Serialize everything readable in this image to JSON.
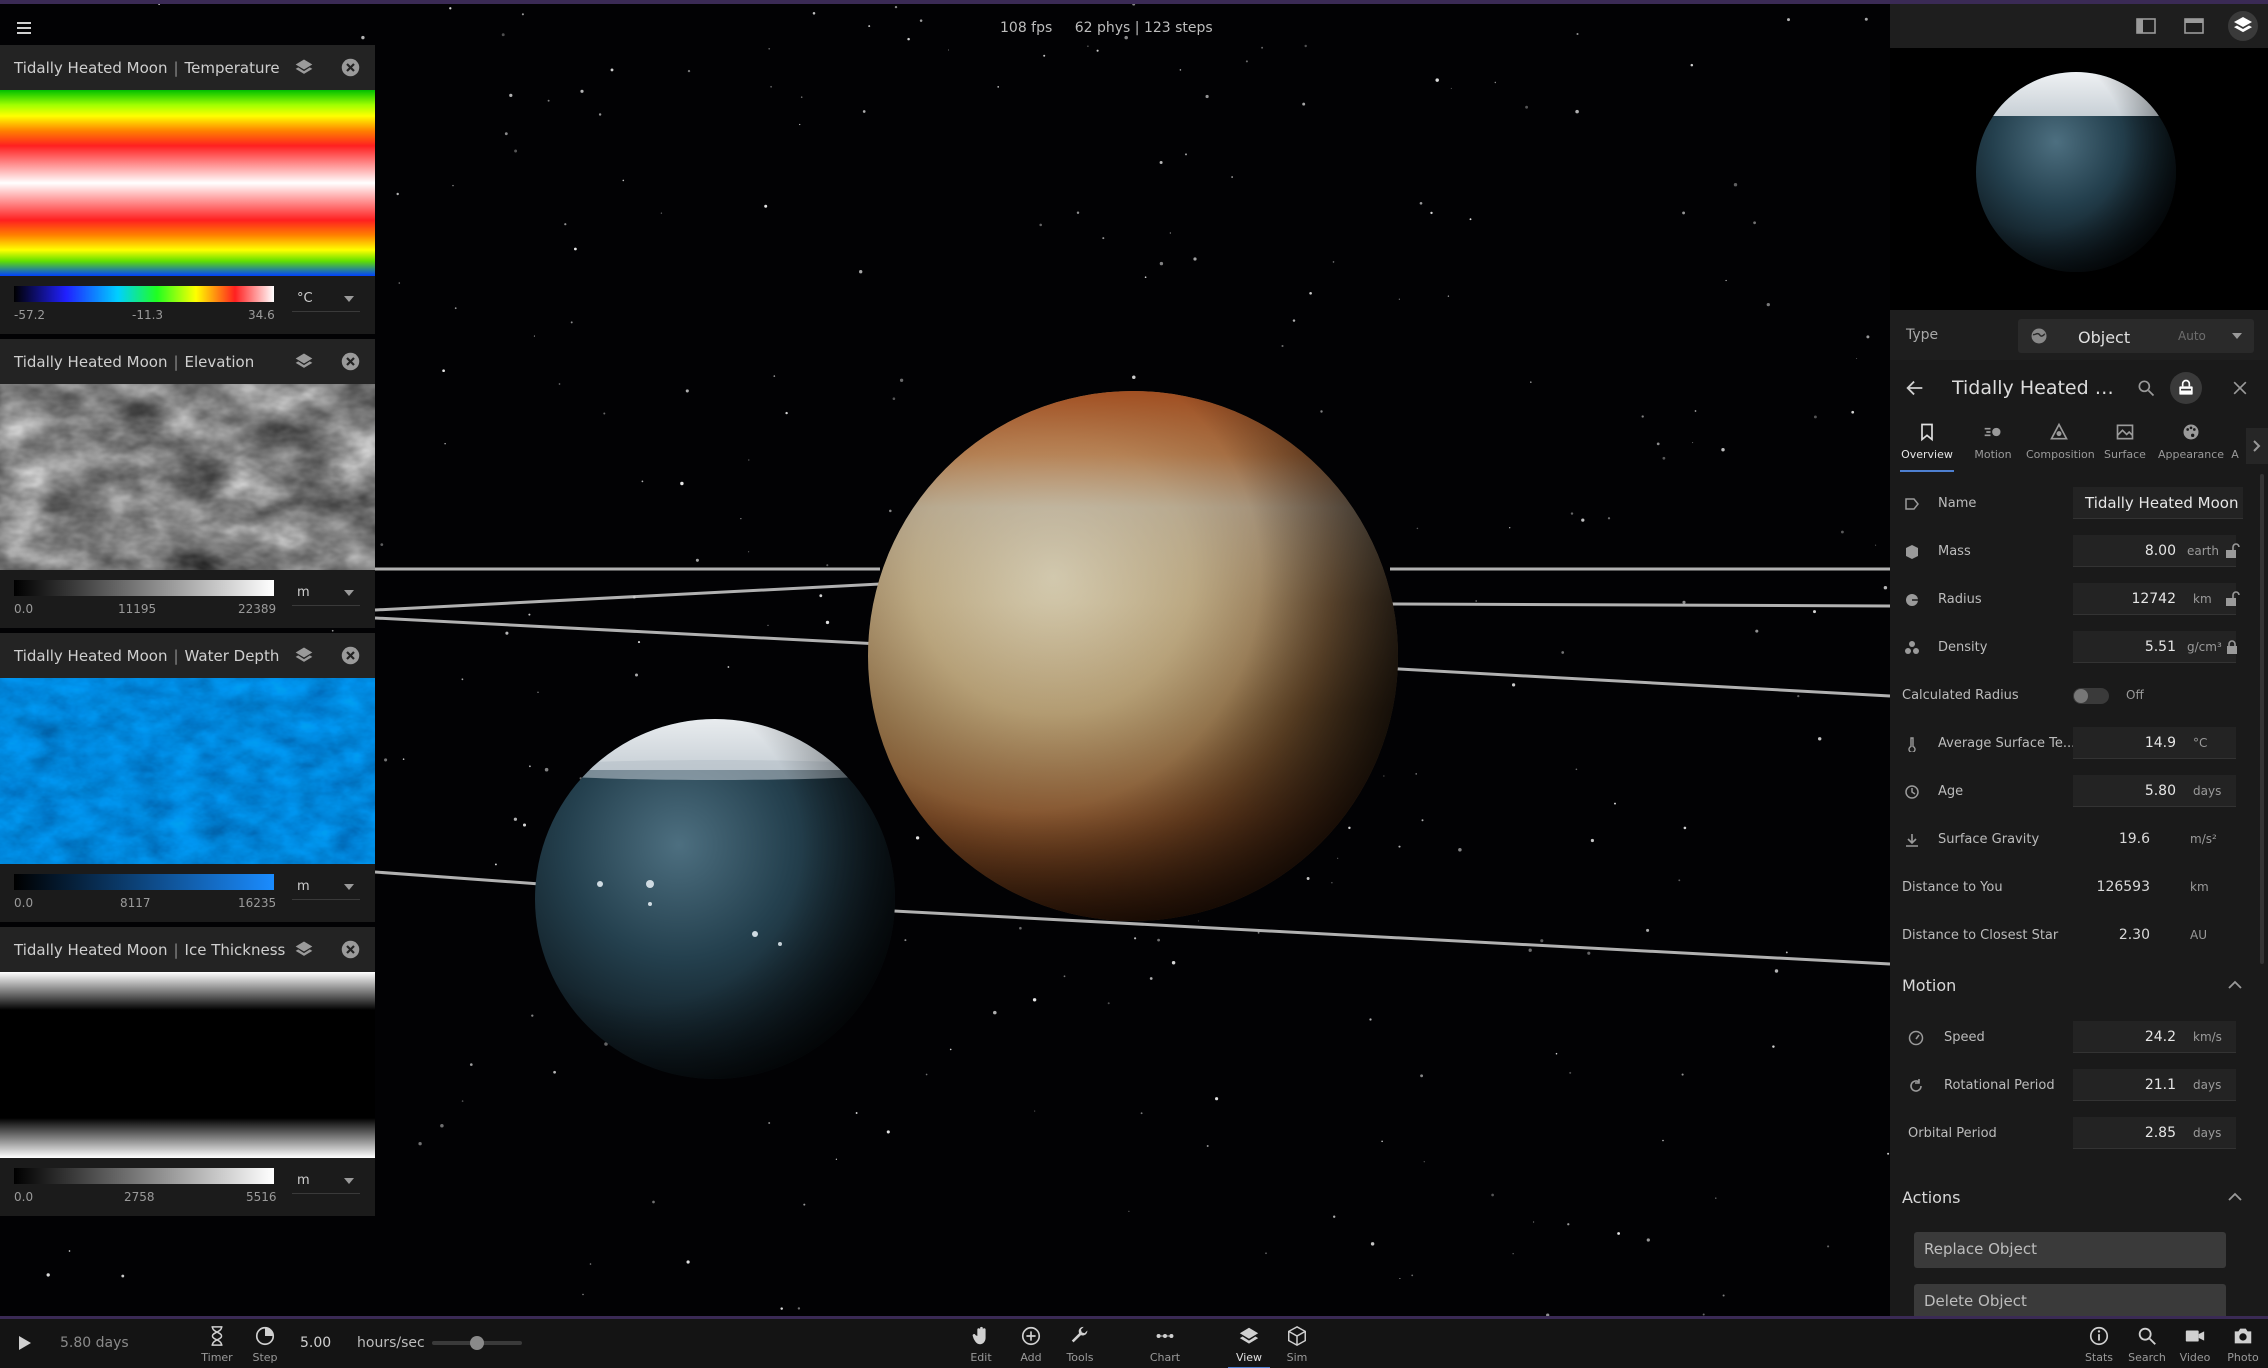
{
  "perf": {
    "fps": "108 fps",
    "phys": "62 phys | 123 steps"
  },
  "maps": [
    {
      "object": "Tidally Heated Moon",
      "sep": "|",
      "layer": "Temperature",
      "min": "-57.2",
      "mid": "-11.3",
      "max": "34.6",
      "unit": "°C"
    },
    {
      "object": "Tidally Heated Moon",
      "sep": "|",
      "layer": "Elevation",
      "min": "0.0",
      "mid": "11195",
      "max": "22389",
      "unit": "m"
    },
    {
      "object": "Tidally Heated Moon",
      "sep": "|",
      "layer": "Water Depth",
      "min": "0.0",
      "mid": "8117",
      "max": "16235",
      "unit": "m"
    },
    {
      "object": "Tidally Heated Moon",
      "sep": "|",
      "layer": "Ice Thickness",
      "min": "0.0",
      "mid": "2758",
      "max": "5516",
      "unit": "m"
    }
  ],
  "panel": {
    "type_label": "Type",
    "type_value": "Object",
    "type_auto": "Auto",
    "object_name": "Tidally Heated Mo...",
    "tabs": [
      {
        "label": "Overview",
        "icon": "bookmark-icon"
      },
      {
        "label": "Motion",
        "icon": "motion-icon"
      },
      {
        "label": "Composition",
        "icon": "composition-icon"
      },
      {
        "label": "Surface",
        "icon": "surface-icon"
      },
      {
        "label": "Appearance",
        "icon": "palette-icon"
      },
      {
        "label": "A",
        "icon": "more-icon"
      }
    ],
    "properties": {
      "name": {
        "label": "Name",
        "value": "Tidally Heated Moon"
      },
      "mass": {
        "label": "Mass",
        "value": "8.00",
        "unit": "earth"
      },
      "radius": {
        "label": "Radius",
        "value": "12742",
        "unit": "km"
      },
      "density": {
        "label": "Density",
        "value": "5.51",
        "unit": "g/cm³"
      },
      "calc_radius": {
        "label": "Calculated Radius",
        "value": "Off"
      },
      "avg_temp": {
        "label": "Average Surface Te...",
        "value": "14.9",
        "unit": "°C"
      },
      "age": {
        "label": "Age",
        "value": "5.80",
        "unit": "days"
      },
      "gravity": {
        "label": "Surface Gravity",
        "value": "19.6",
        "unit": "m/s²"
      },
      "dist_you": {
        "label": "Distance to You",
        "value": "126593",
        "unit": "km"
      },
      "dist_star": {
        "label": "Distance to Closest Star",
        "value": "2.30",
        "unit": "AU"
      }
    },
    "motion": {
      "title": "Motion",
      "speed": {
        "label": "Speed",
        "value": "24.2",
        "unit": "km/s"
      },
      "rot_period": {
        "label": "Rotational Period",
        "value": "21.1",
        "unit": "days"
      },
      "orb_period": {
        "label": "Orbital Period",
        "value": "2.85",
        "unit": "days"
      }
    },
    "actions": {
      "title": "Actions",
      "replace": "Replace Object",
      "delete": "Delete Object"
    }
  },
  "toolbar": {
    "time": "5.80 days",
    "timer": "Timer",
    "step": "Step",
    "rate": "5.00",
    "rate_unit": "hours/sec",
    "rate_slider_level": 0.5,
    "center": [
      {
        "label": "Edit",
        "icon": "hand-icon"
      },
      {
        "label": "Add",
        "icon": "plus-circle-icon"
      },
      {
        "label": "Tools",
        "icon": "wrench-icon"
      },
      {
        "label": "Chart",
        "icon": "chart-icon"
      },
      {
        "label": "View",
        "icon": "layers-icon"
      },
      {
        "label": "Sim",
        "icon": "cube-icon"
      }
    ],
    "right": [
      {
        "label": "Stats",
        "icon": "info-icon"
      },
      {
        "label": "Search",
        "icon": "search-icon"
      },
      {
        "label": "Video",
        "icon": "video-icon"
      },
      {
        "label": "Photo",
        "icon": "camera-icon"
      }
    ]
  },
  "colors": {
    "accent": "#4d7fd0",
    "panel": "#1a1a1a",
    "top_accent": "#3a2a55"
  }
}
